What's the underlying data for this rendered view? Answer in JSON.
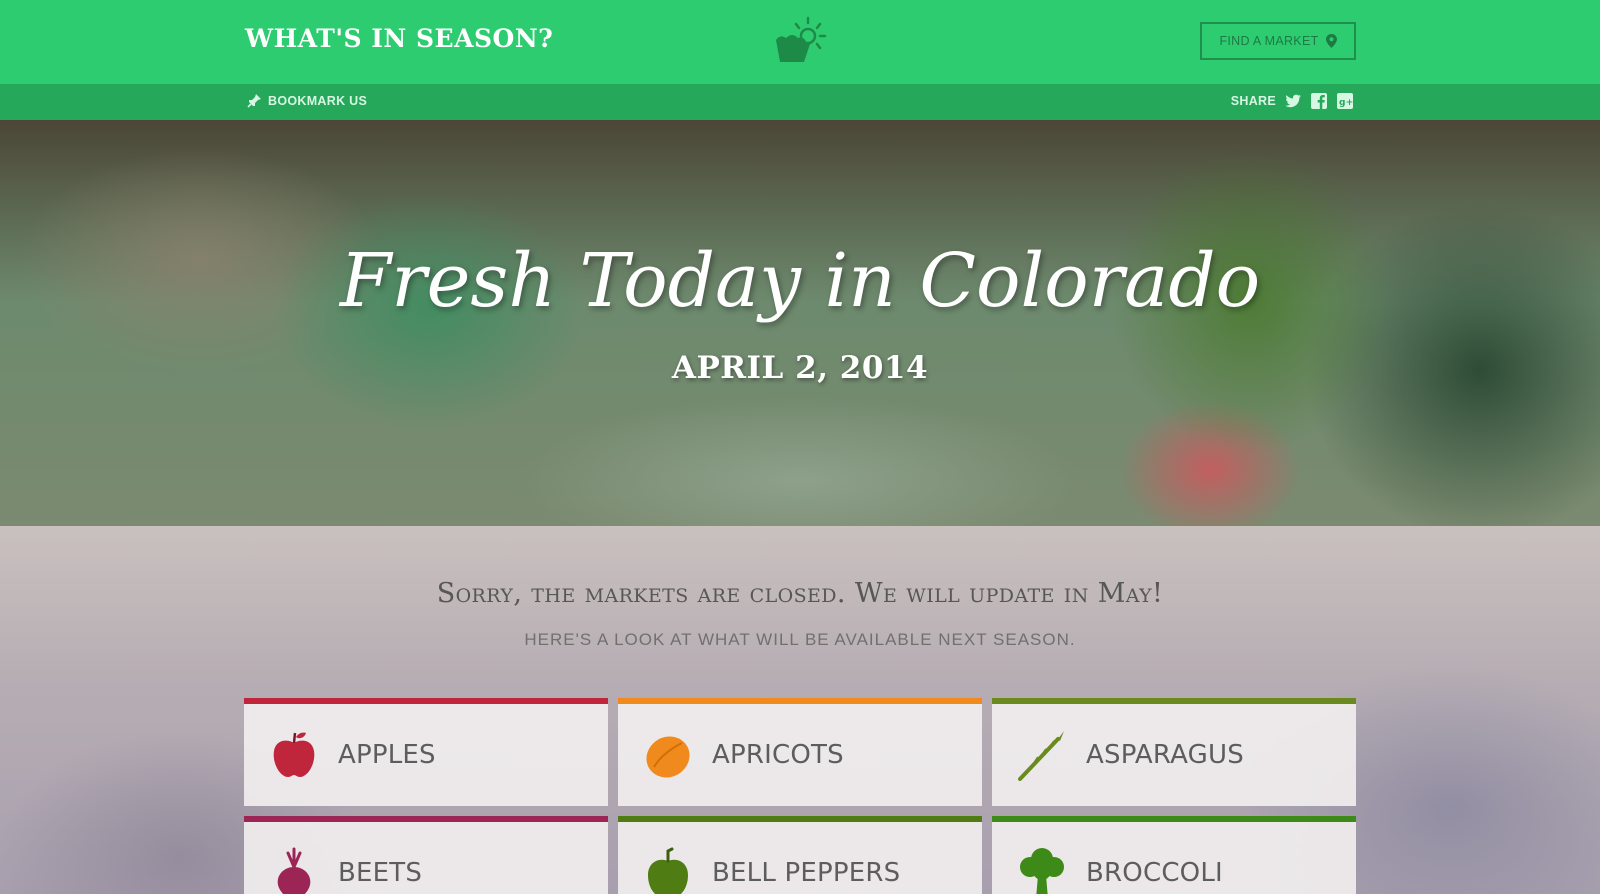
{
  "header": {
    "brand": "WHAT'S IN SEASON?",
    "find_market_label": "FIND A MARKET",
    "logo_icon": "basket-sun-icon",
    "accent_color": "#2ecc71"
  },
  "subbar": {
    "bookmark_label": "BOOKMARK US",
    "share_label": "SHARE",
    "share_icons": [
      "twitter-icon",
      "facebook-icon",
      "google-plus-icon"
    ]
  },
  "hero": {
    "title": "Fresh Today in Colorado",
    "date": "APRIL 2, 2014"
  },
  "notice": {
    "headline": "Sorry, the markets are closed. We will update in May!",
    "subline": "HERE'S A LOOK AT WHAT WILL BE AVAILABLE NEXT SEASON."
  },
  "produce": [
    {
      "label": "APPLES",
      "color": "#c0263b",
      "icon": "apple-icon"
    },
    {
      "label": "APRICOTS",
      "color": "#f08a1c",
      "icon": "apricot-icon"
    },
    {
      "label": "ASPARAGUS",
      "color": "#6b8a1e",
      "icon": "asparagus-icon"
    },
    {
      "label": "BEETS",
      "color": "#9c2556",
      "icon": "beet-icon"
    },
    {
      "label": "BELL PEPPERS",
      "color": "#4f7d14",
      "icon": "bell-pepper-icon"
    },
    {
      "label": "BROCCOLI",
      "color": "#3d8a18",
      "icon": "broccoli-icon"
    }
  ]
}
